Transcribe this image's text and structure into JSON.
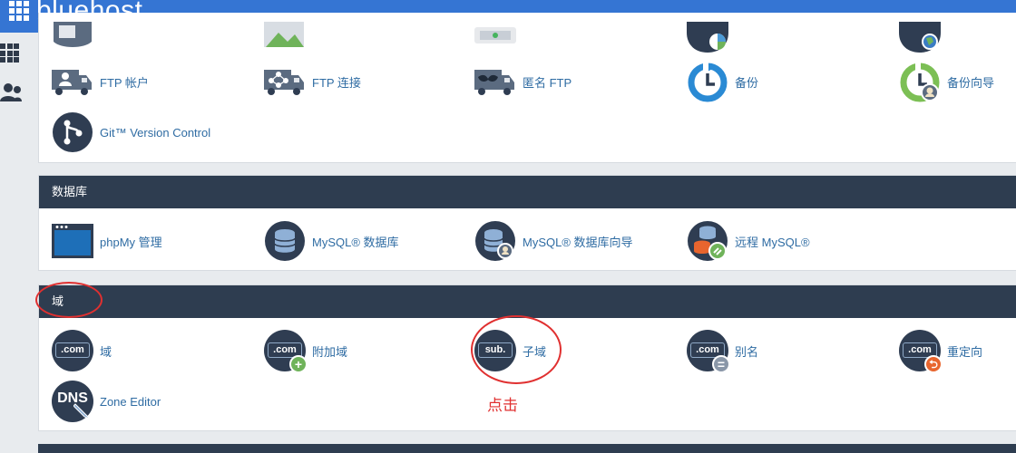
{
  "header": {
    "brand": "bluehost"
  },
  "files_section": {
    "items": [
      {
        "label": "FTP 帐户"
      },
      {
        "label": "FTP 连接"
      },
      {
        "label": "匿名 FTP"
      },
      {
        "label": "备份"
      },
      {
        "label": "备份向导"
      },
      {
        "label": "Git™ Version Control"
      }
    ]
  },
  "databases_section": {
    "title": "数据库",
    "items": [
      {
        "label": "phpMy 管理"
      },
      {
        "label": "MySQL® 数据库"
      },
      {
        "label": "MySQL® 数据库向导"
      },
      {
        "label": "远程 MySQL®"
      }
    ]
  },
  "domains_section": {
    "title": "域",
    "items": [
      {
        "label": "域",
        "icon_text": ".com"
      },
      {
        "label": "附加域",
        "icon_text": ".com"
      },
      {
        "label": "子域",
        "icon_text": "sub."
      },
      {
        "label": "别名",
        "icon_text": ".com"
      },
      {
        "label": "重定向",
        "icon_text": ".com"
      },
      {
        "label": "Zone Editor",
        "icon_text": "DNS"
      }
    ]
  },
  "annotation": {
    "text": "点击"
  },
  "colors": {
    "topbar": "#3575d3",
    "section_header": "#2e3d50",
    "link": "#2f6ca3",
    "annotation": "#e03030"
  }
}
